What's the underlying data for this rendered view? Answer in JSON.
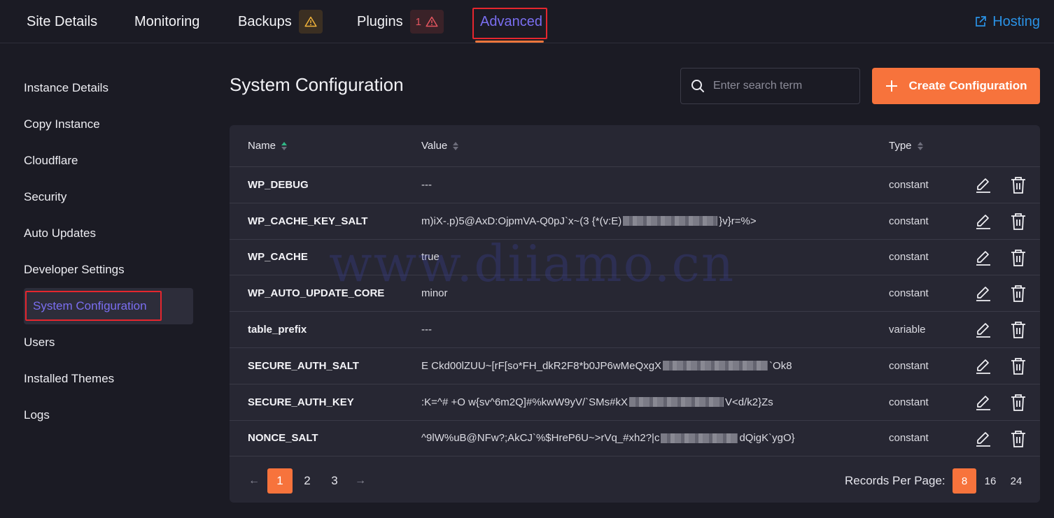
{
  "nav": {
    "tabs": [
      {
        "label": "Site Details"
      },
      {
        "label": "Monitoring"
      },
      {
        "label": "Backups",
        "badge_icon": "warning-icon"
      },
      {
        "label": "Plugins",
        "badge_count": "1",
        "badge_icon": "warning-icon"
      },
      {
        "label": "Advanced",
        "active": true
      }
    ],
    "hosting_label": "Hosting"
  },
  "sidebar": {
    "items": [
      {
        "label": "Instance Details"
      },
      {
        "label": "Copy Instance"
      },
      {
        "label": "Cloudflare"
      },
      {
        "label": "Security"
      },
      {
        "label": "Auto Updates"
      },
      {
        "label": "Developer Settings"
      },
      {
        "label": "System Configuration",
        "active": true
      },
      {
        "label": "Users"
      },
      {
        "label": "Installed Themes"
      },
      {
        "label": "Logs"
      }
    ]
  },
  "main": {
    "title": "System Configuration",
    "search_placeholder": "Enter search term",
    "create_label": "Create Configuration"
  },
  "table": {
    "columns": {
      "name": "Name",
      "value": "Value",
      "type": "Type"
    },
    "rows": [
      {
        "name": "WP_DEBUG",
        "value_a": "---",
        "value_b": "",
        "type": "constant"
      },
      {
        "name": "WP_CACHE_KEY_SALT",
        "value_a": "m)iX-.p)5@AxD:OjpmVA-Q0pJ`x~(3 {*(v:E)",
        "value_b": "}v}r=%>",
        "type": "constant"
      },
      {
        "name": "WP_CACHE",
        "value_a": "true",
        "value_b": "",
        "type": "constant"
      },
      {
        "name": "WP_AUTO_UPDATE_CORE",
        "value_a": "minor",
        "value_b": "",
        "type": "constant"
      },
      {
        "name": "table_prefix",
        "value_a": "---",
        "value_b": "",
        "type": "variable"
      },
      {
        "name": "SECURE_AUTH_SALT",
        "value_a": "E Ckd00lZUU~[rF[so*FH_dkR2F8*b0JP6wMeQxgX",
        "value_b": "`Ok8",
        "type": "constant"
      },
      {
        "name": "SECURE_AUTH_KEY",
        "value_a": ":K=^# +O w{sv^6m2Q]#%kwW9yV/`SMs#kX",
        "value_b": "V<d/k2}Zs",
        "type": "constant"
      },
      {
        "name": "NONCE_SALT",
        "value_a": "^9lW%uB@NFw?;AkCJ`%$HreP6U~>rVq_#xh2?|c",
        "value_b": "dQigK`ygO}",
        "type": "constant"
      }
    ]
  },
  "pagination": {
    "prev": "←",
    "pages": [
      "1",
      "2",
      "3"
    ],
    "current_page": "1",
    "next": "→",
    "records_label": "Records Per Page:",
    "per_page_options": [
      "8",
      "16",
      "24"
    ],
    "per_page_selected": "8"
  },
  "watermark": "www.diiamo.cn",
  "colors": {
    "accent": "#f7733c",
    "active_purple": "#7a6ef0",
    "link_blue": "#2a92e5",
    "highlight_red": "#e5262e"
  }
}
